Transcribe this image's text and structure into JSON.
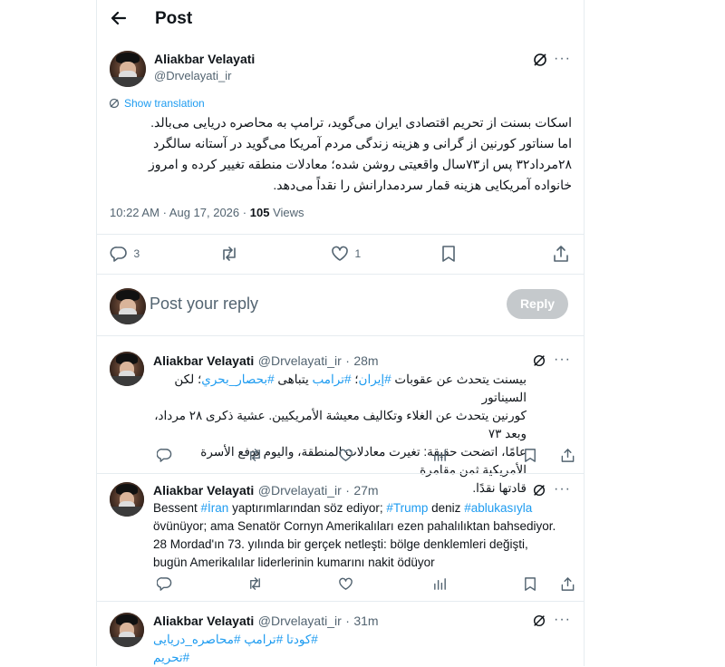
{
  "header": {
    "title": "Post",
    "back_icon": "arrow-left-icon"
  },
  "main_post": {
    "author_name": "Aliakbar Velayati",
    "author_handle": "@Drvelayati_ir",
    "show_translation": "Show translation",
    "lines": [
      "اسکات بسنت از تحریم اقتصادی ایران می‌گوید، ترامپ به محاصره دریایی می‌بالد.",
      "اما سناتور کورنین از گرانی و هزینه زندگی مردم آمریکا می‌گوید در آستانه سالگرد",
      "۲۸مرداد۳۲ پس از۷۳سال واقعیتی روشن شده؛ معادلات منطقه تغییر کرده و امروز",
      "خانواده آمریکایی هزینه قمار سردمدارانش را نقداً می‌دهد."
    ],
    "time": "10:22 AM",
    "date": "Aug 17, 2026",
    "views_count": "105",
    "views_label": "Views",
    "reply_count": "3",
    "like_count": "1"
  },
  "compose": {
    "placeholder": "Post your reply",
    "button_label": "Reply"
  },
  "replies": [
    {
      "author_name": "Aliakbar Velayati",
      "author_handle": "@Drvelayati_ir",
      "time": "28m",
      "lines": [
        [
          {
            "t": "بيسنت يتحدث عن عقوبات "
          },
          {
            "t": "#إيران",
            "h": true
          },
          {
            "t": "؛ "
          },
          {
            "t": "#ترامب",
            "h": true
          },
          {
            "t": " يتباهى "
          },
          {
            "t": "#بحصار_بحري",
            "h": true
          },
          {
            "t": "؛ لكن السيناتور"
          }
        ],
        [
          {
            "t": "كورنين يتحدث عن الغلاء وتكاليف معيشة الأمريكيين. عشية ذكرى ٢٨ مرداد، وبعد ٧٣"
          }
        ],
        [
          {
            "t": "عامًا، اتضحت حقيقة: تغيرت معادلات المنطقة، واليوم تدفع الأسرة الأمريكية ثمن مقامرة"
          }
        ],
        [
          {
            "t": "قادتها نقدًا."
          }
        ]
      ]
    },
    {
      "author_name": "Aliakbar Velayati",
      "author_handle": "@Drvelayati_ir",
      "time": "27m",
      "lines": [
        [
          {
            "t": "Bessent "
          },
          {
            "t": "#İran",
            "h": true
          },
          {
            "t": " yaptırımlarından söz ediyor; "
          },
          {
            "t": "#Trump",
            "h": true
          },
          {
            "t": " deniz "
          },
          {
            "t": "#ablukasıyla",
            "h": true
          }
        ],
        [
          {
            "t": "övünüyor; ama Senatör Cornyn Amerikalıları ezen pahalılıktan bahsediyor."
          }
        ],
        [
          {
            "t": "28 Mordad'ın 73. yılında bir gerçek netleşti: bölge denklemleri değişti,"
          }
        ],
        [
          {
            "t": "bugün Amerikalılar liderlerinin kumarını nakit ödüyor"
          }
        ]
      ]
    },
    {
      "author_name": "Aliakbar Velayati",
      "author_handle": "@Drvelayati_ir",
      "time": "31m",
      "lines": [
        [
          {
            "t": "#کودتا",
            "h": true
          },
          {
            "t": " "
          },
          {
            "t": "#ترامپ",
            "h": true
          },
          {
            "t": " "
          },
          {
            "t": "#محاصره_دریایی",
            "h": true
          },
          {
            "t": " "
          },
          {
            "t": "#تحریم",
            "h": true
          }
        ]
      ]
    }
  ],
  "icons": {
    "grok": "grok-icon",
    "more": "more-icon",
    "reply": "reply-icon",
    "repost": "repost-icon",
    "like": "heart-icon",
    "bookmark": "bookmark-icon",
    "share": "share-icon",
    "views": "views-icon"
  },
  "colors": {
    "accent": "#1d9bf0",
    "text": "#0f1419",
    "muted": "#536471",
    "border": "#e6ecf0",
    "reply_button": "#c5c9cc"
  }
}
